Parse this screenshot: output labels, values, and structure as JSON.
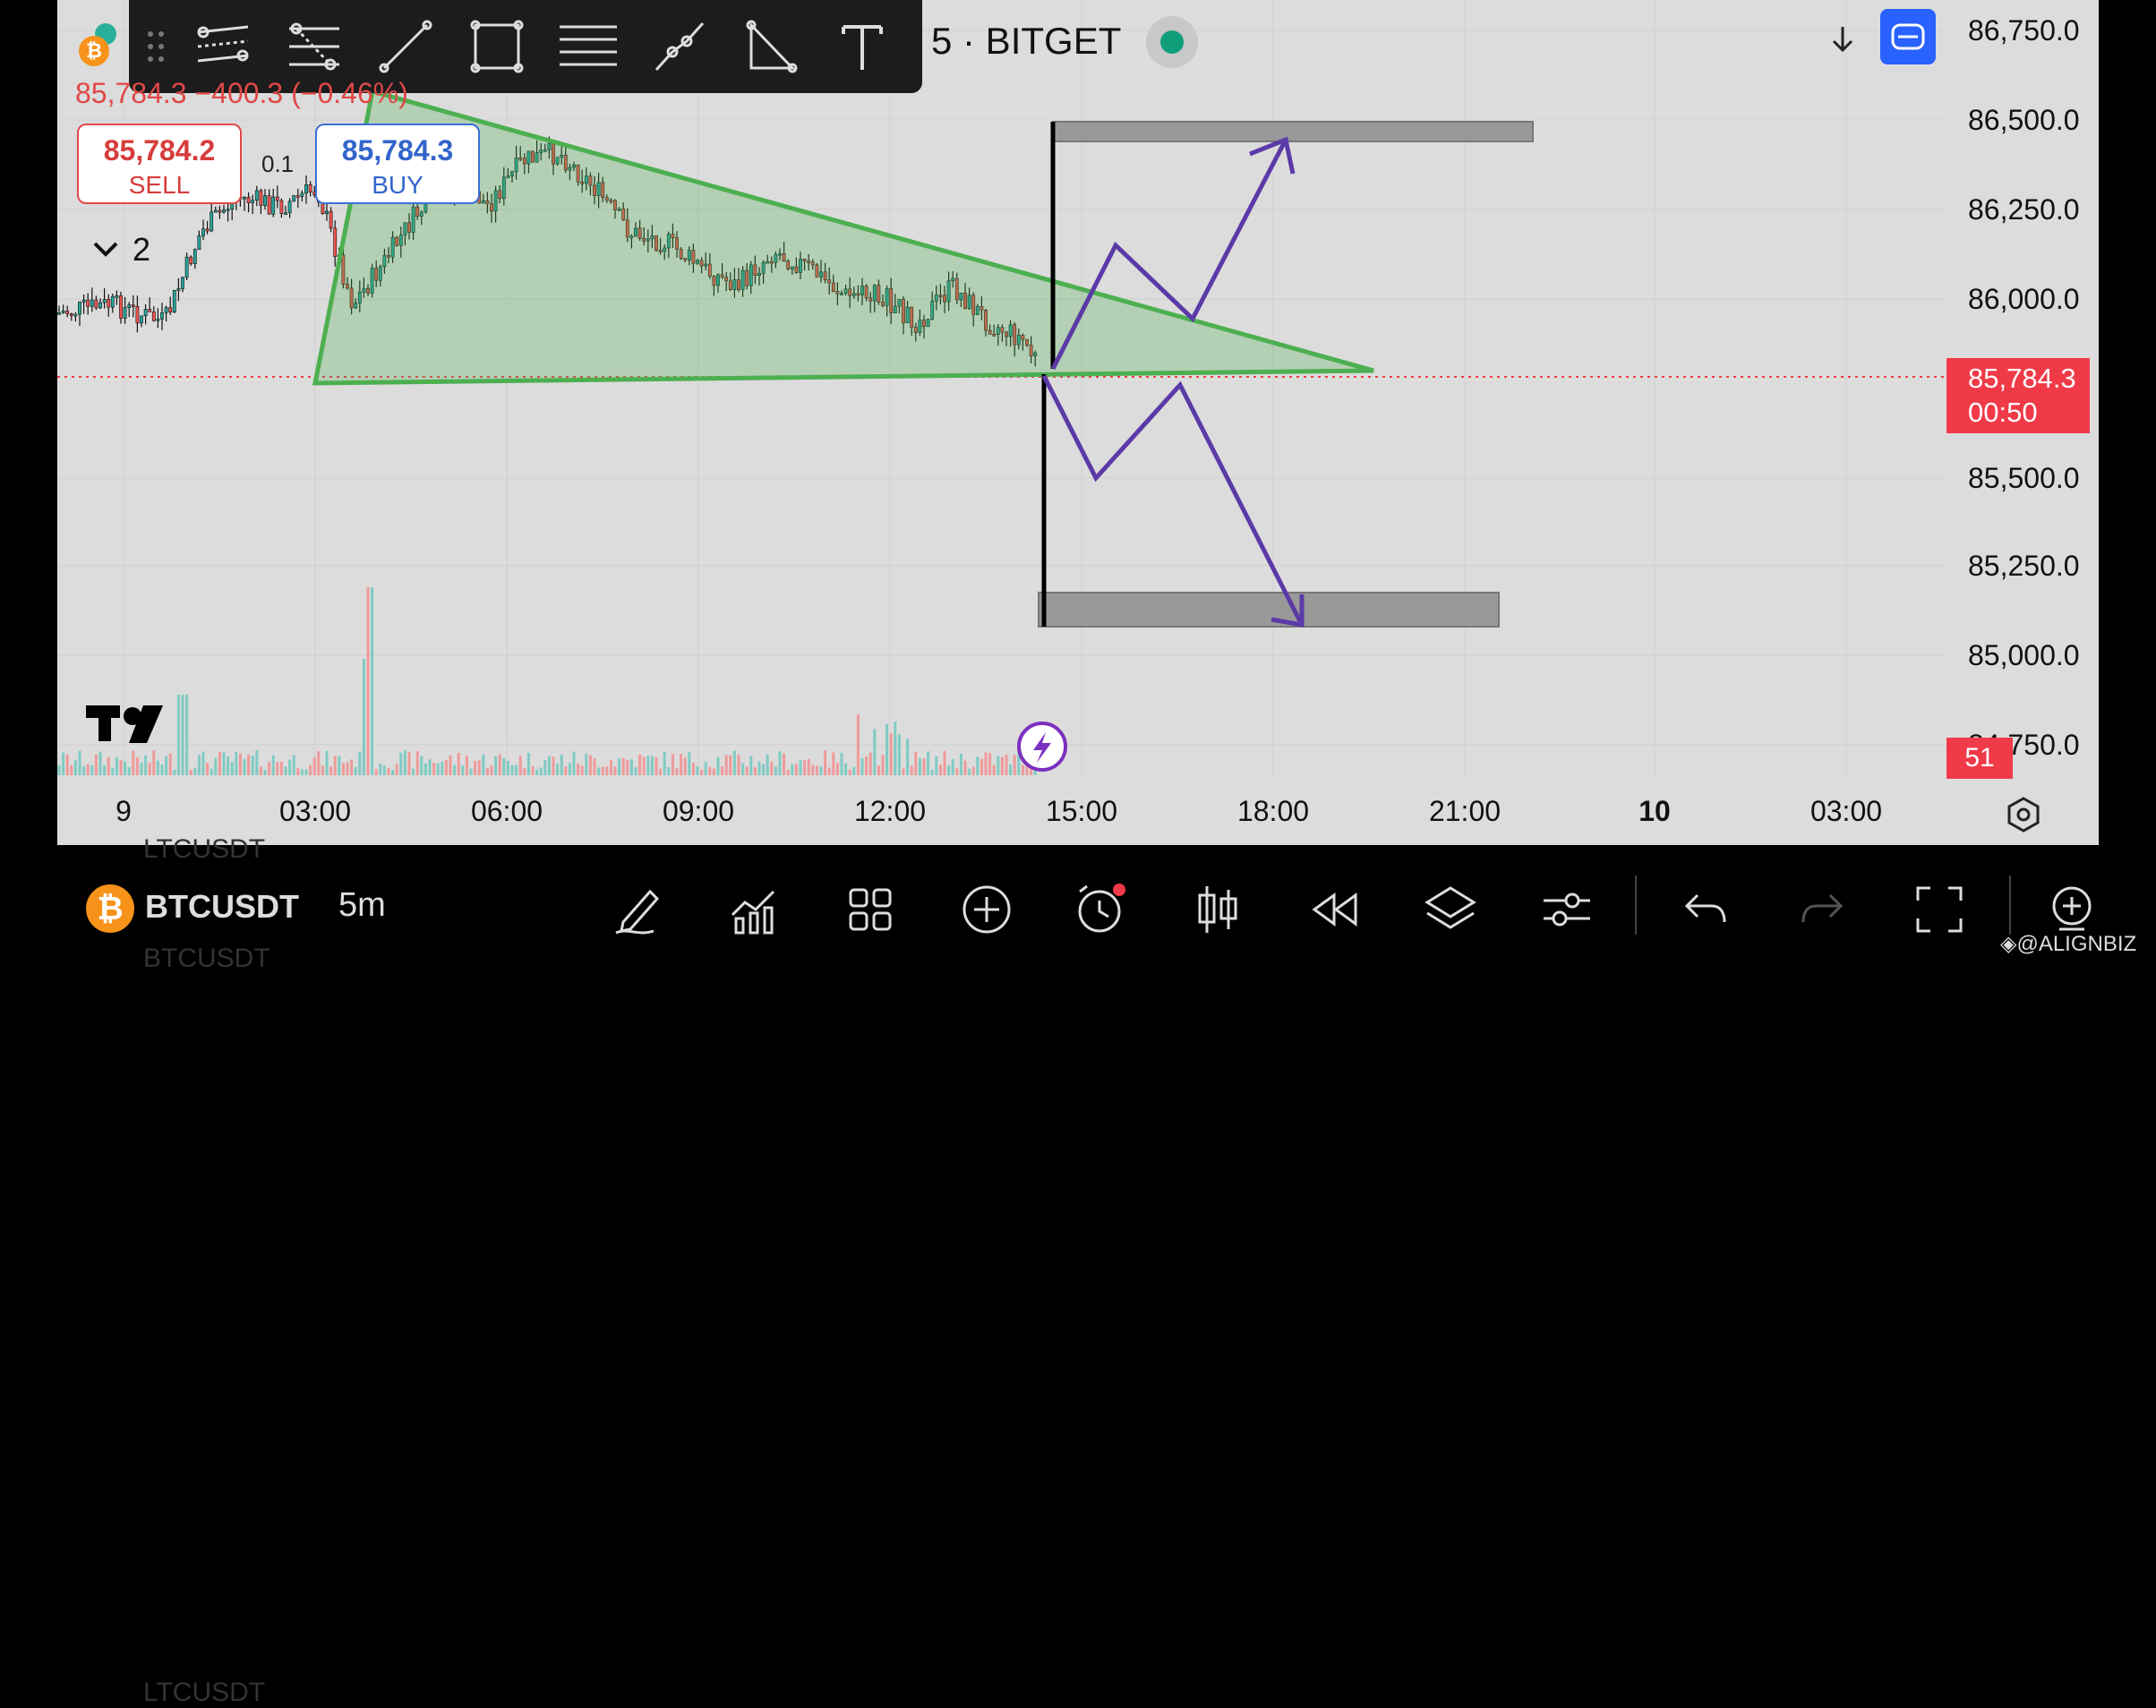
{
  "symbol": {
    "title": "5 · BITGET",
    "name": "BTCUSDT",
    "ghost_top": "LTCUSDT",
    "ghost_bottom": "BTCUSDT",
    "interval": "5m",
    "logo_glyph": "₿"
  },
  "price_change": "85,784.3 −400.3 (−0.46%)",
  "sell": {
    "price": "85,784.2",
    "label": "SELL"
  },
  "buy": {
    "price": "85,784.3",
    "label": "BUY"
  },
  "spread": "0.1",
  "indicators_toggle": "2",
  "price_axis": [
    "86,750.0",
    "86,500.0",
    "86,250.0",
    "86,000.0",
    "85,500.0",
    "85,250.0",
    "85,000.0",
    "84,750.0"
  ],
  "last_price": {
    "price": "85,784.3",
    "countdown": "00:50"
  },
  "volume_tag": "51",
  "time_axis": [
    "9",
    "03:00",
    "06:00",
    "09:00",
    "12:00",
    "15:00",
    "18:00",
    "21:00",
    "10",
    "03:00"
  ],
  "drawing_tools": [
    "parallel-channel-icon",
    "regression-trend-icon",
    "trend-line-icon",
    "rectangle-icon",
    "horizontal-lines-icon",
    "path-icon",
    "triangle-pattern-icon",
    "text-tool-icon"
  ],
  "bottom_tools": [
    "draw-icon",
    "indicators-icon",
    "layout-icon",
    "add-icon",
    "alert-icon",
    "chart-type-icon",
    "replay-icon",
    "layers-icon",
    "settings-icon",
    "undo-icon",
    "redo-icon",
    "fullscreen-icon",
    "zoom-icon"
  ],
  "watermark": "◈@ALIGNBIZ",
  "colors": {
    "up": "#26a69a",
    "down": "#ef5350",
    "triangle": "#4caf50",
    "arrows": "#5b3aa8",
    "accent": "#2962ff",
    "last_price": "#f03a48"
  }
}
